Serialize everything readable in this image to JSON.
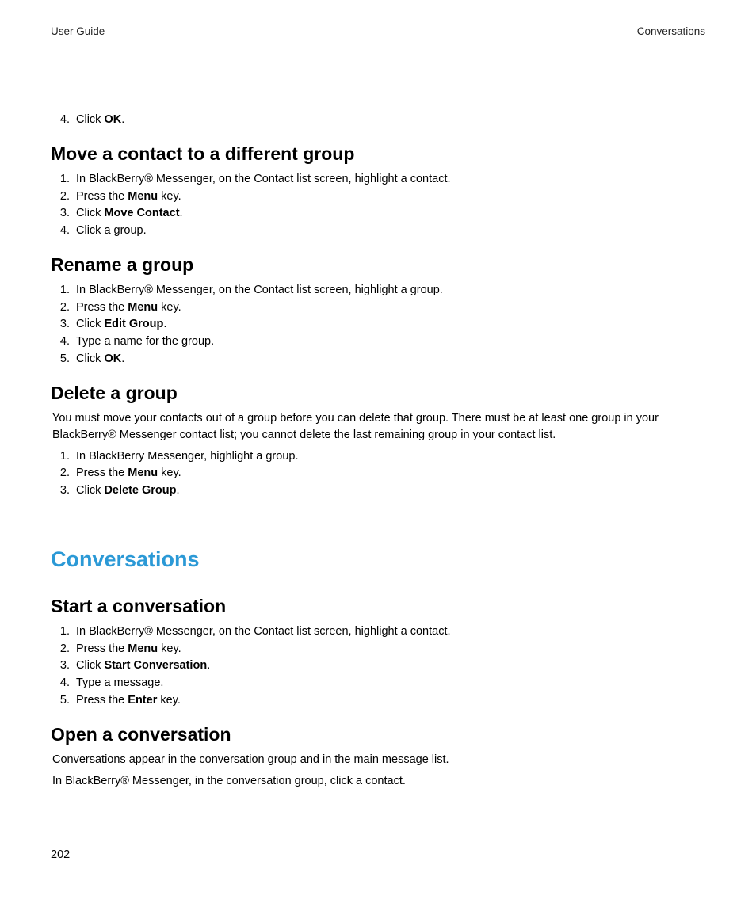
{
  "header": {
    "left": "User Guide",
    "right": "Conversations"
  },
  "orphan_step": {
    "num": "4.",
    "pre": "Click ",
    "bold": "OK",
    "post": "."
  },
  "sections": {
    "move": {
      "title": "Move a contact to a different group",
      "steps": [
        {
          "num": "1.",
          "text": "In BlackBerry® Messenger, on the Contact list screen, highlight a contact."
        },
        {
          "num": "2.",
          "pre": "Press the ",
          "bold": "Menu",
          "post": " key."
        },
        {
          "num": "3.",
          "pre": "Click ",
          "bold": "Move Contact",
          "post": "."
        },
        {
          "num": "4.",
          "text": "Click a group."
        }
      ]
    },
    "rename": {
      "title": "Rename a group",
      "steps": [
        {
          "num": "1.",
          "text": "In BlackBerry® Messenger, on the Contact list screen, highlight a group."
        },
        {
          "num": "2.",
          "pre": "Press the ",
          "bold": "Menu",
          "post": " key."
        },
        {
          "num": "3.",
          "pre": "Click ",
          "bold": "Edit Group",
          "post": "."
        },
        {
          "num": "4.",
          "text": "Type a name for the group."
        },
        {
          "num": "5.",
          "pre": "Click ",
          "bold": "OK",
          "post": "."
        }
      ]
    },
    "delete": {
      "title": "Delete a group",
      "intro": "You must move your contacts out of a group before you can delete that group. There must be at least one group in your BlackBerry® Messenger contact list; you cannot delete the last remaining group in your contact list.",
      "steps": [
        {
          "num": "1.",
          "text": "In BlackBerry Messenger, highlight a group."
        },
        {
          "num": "2.",
          "pre": "Press the ",
          "bold": "Menu",
          "post": " key."
        },
        {
          "num": "3.",
          "pre": "Click ",
          "bold": "Delete Group",
          "post": "."
        }
      ]
    },
    "conv_heading": "Conversations",
    "start": {
      "title": "Start a conversation",
      "steps": [
        {
          "num": "1.",
          "text": "In BlackBerry® Messenger, on the Contact list screen, highlight a contact."
        },
        {
          "num": "2.",
          "pre": "Press the ",
          "bold": "Menu",
          "post": " key."
        },
        {
          "num": "3.",
          "pre": "Click ",
          "bold": "Start Conversation",
          "post": "."
        },
        {
          "num": "4.",
          "text": "Type a message."
        },
        {
          "num": "5.",
          "pre": "Press the ",
          "bold": "Enter",
          "post": " key."
        }
      ]
    },
    "open": {
      "title": "Open a conversation",
      "p1": "Conversations appear in the conversation group and in the main message list.",
      "p2": "In BlackBerry® Messenger, in the conversation group, click a contact."
    }
  },
  "page_number": "202"
}
